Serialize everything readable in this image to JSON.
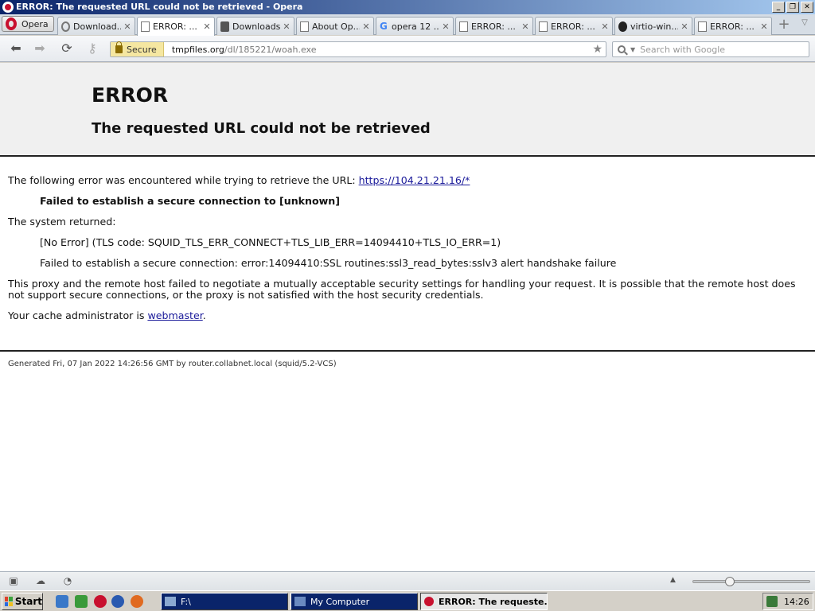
{
  "window": {
    "title": "ERROR: The requested URL could not be retrieved - Opera",
    "controls": [
      "_",
      "❐",
      "✕"
    ]
  },
  "browser": {
    "menu_label": "Opera",
    "tabs": [
      {
        "label": "Download...",
        "icon": "download-icon"
      },
      {
        "label": "ERROR: ...",
        "icon": "page-icon",
        "active": true
      },
      {
        "label": "Downloads",
        "icon": "downloads-icon"
      },
      {
        "label": "About Op...",
        "icon": "page-icon"
      },
      {
        "label": "opera 12 ...",
        "icon": "google-icon"
      },
      {
        "label": "ERROR: ...",
        "icon": "page-icon"
      },
      {
        "label": "ERROR: ...",
        "icon": "page-icon"
      },
      {
        "label": "virtio-win...",
        "icon": "github-icon"
      },
      {
        "label": "ERROR: ...",
        "icon": "page-icon"
      }
    ],
    "tab_close": "✕",
    "new_tab": "+",
    "address": {
      "secure_label": "Secure",
      "host": "tmpfiles.org",
      "path": "/dl/185221/woah.exe"
    },
    "search_placeholder": "Search with Google"
  },
  "page": {
    "title": "ERROR",
    "subtitle": "The requested URL could not be retrieved",
    "line1_prefix": "The following error was encountered while trying to retrieve the URL: ",
    "line1_url": "https://104.21.21.16/*",
    "line2": "Failed to establish a secure connection to [unknown]",
    "line3": "The system returned:",
    "line4": "[No Error] (TLS code: SQUID_TLS_ERR_CONNECT+TLS_LIB_ERR=14094410+TLS_IO_ERR=1)",
    "line5": "Failed to establish a secure connection: error:14094410:SSL routines:ssl3_read_bytes:sslv3 alert handshake failure",
    "line6": "This proxy and the remote host failed to negotiate a mutually acceptable security settings for handling your request. It is possible that the remote host does not support secure connections, or the proxy is not satisfied with the host security credentials.",
    "line7_prefix": "Your cache administrator is ",
    "line7_link": "webmaster",
    "line7_suffix": ".",
    "generated": "Generated Fri, 07 Jan 2022 14:26:56 GMT by router.collabnet.local (squid/5.2-VCS)"
  },
  "statusbar": {
    "zoom_level": 0.3
  },
  "taskbar": {
    "start_label": "Start",
    "tasks": [
      {
        "label": "F:\\",
        "active": false
      },
      {
        "label": "My Computer",
        "active": false
      },
      {
        "label": "ERROR: The requeste...",
        "active": true
      }
    ],
    "clock": "14:26"
  },
  "colors": {
    "link": "#1a0dab",
    "titlebar_start": "#0a246a",
    "opera_red": "#c8102e",
    "secure_bg": "#f5e7a1"
  }
}
